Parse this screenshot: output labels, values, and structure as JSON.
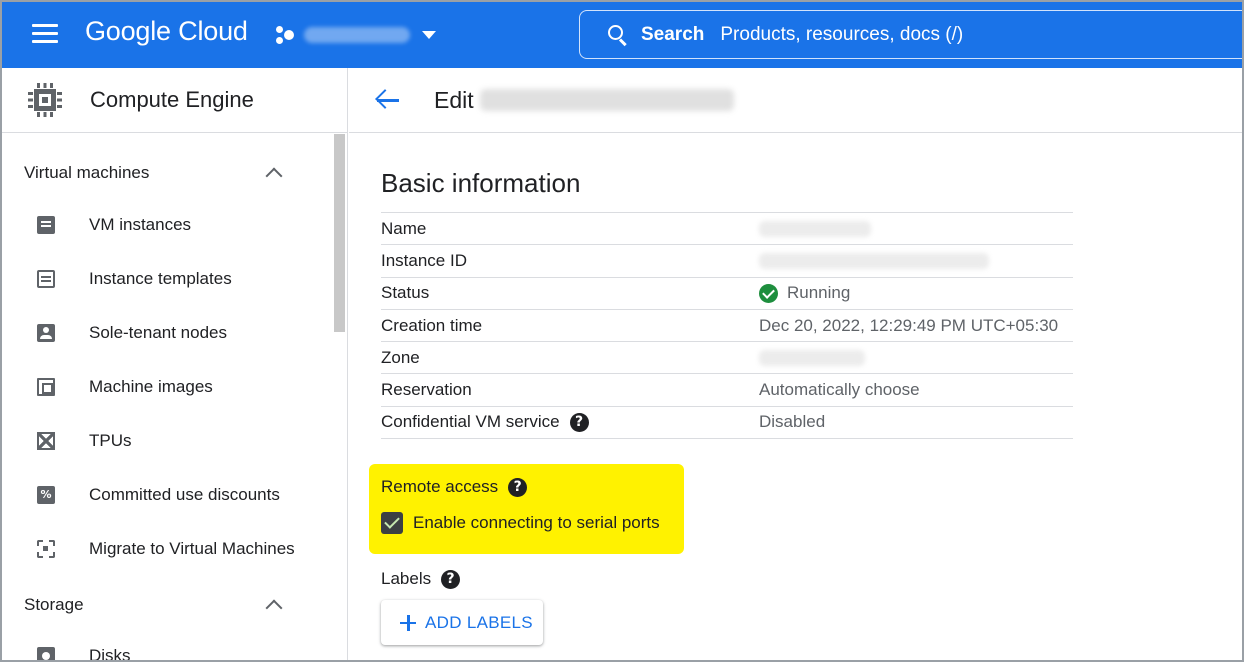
{
  "header": {
    "logo": "Google Cloud",
    "search_label": "Search",
    "search_hint": "Products, resources, docs (/)"
  },
  "sidebar": {
    "product_title": "Compute Engine",
    "sections": [
      {
        "label": "Virtual machines",
        "items": [
          {
            "label": "VM instances",
            "icon": "vm-instances-icon"
          },
          {
            "label": "Instance templates",
            "icon": "instance-templates-icon"
          },
          {
            "label": "Sole-tenant nodes",
            "icon": "sole-tenant-icon"
          },
          {
            "label": "Machine images",
            "icon": "machine-images-icon"
          },
          {
            "label": "TPUs",
            "icon": "tpu-icon"
          },
          {
            "label": "Committed use discounts",
            "icon": "percent-icon"
          },
          {
            "label": "Migrate to Virtual Machines",
            "icon": "migrate-icon"
          }
        ]
      },
      {
        "label": "Storage",
        "items": [
          {
            "label": "Disks",
            "icon": "disk-icon"
          }
        ]
      }
    ]
  },
  "main": {
    "page_title_prefix": "Edit",
    "section_title": "Basic information",
    "info_rows": [
      {
        "key": "Name",
        "value": ""
      },
      {
        "key": "Instance ID",
        "value": ""
      },
      {
        "key": "Status",
        "value": "Running"
      },
      {
        "key": "Creation time",
        "value": "Dec 20, 2022, 12:29:49 PM UTC+05:30"
      },
      {
        "key": "Zone",
        "value": ""
      },
      {
        "key": "Reservation",
        "value": "Automatically choose"
      },
      {
        "key": "Confidential VM service",
        "value": "Disabled"
      }
    ],
    "remote_access_label": "Remote access",
    "serial_ports_label": "Enable connecting to serial ports",
    "serial_ports_checked": true,
    "labels_label": "Labels",
    "add_labels_button": "ADD LABELS"
  },
  "colors": {
    "brand_blue": "#1a73e8",
    "highlight": "#fff200",
    "status_green": "#1e8e3e"
  }
}
